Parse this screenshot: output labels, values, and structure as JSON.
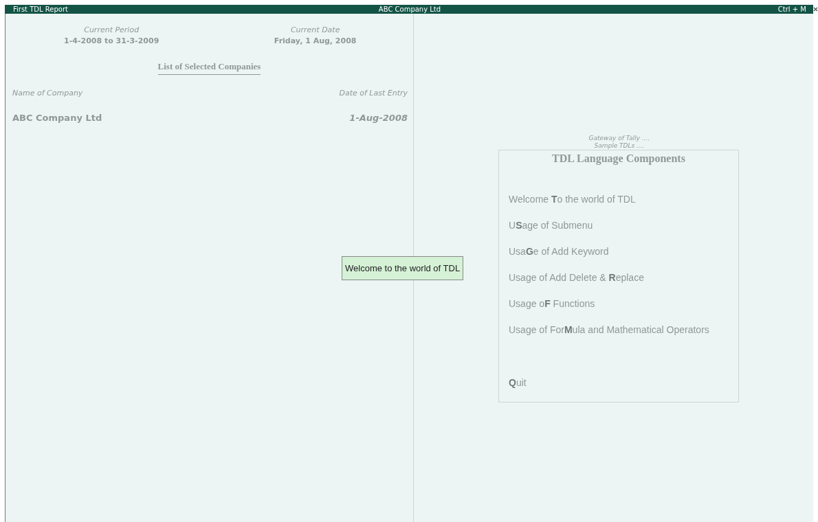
{
  "title_bar": {
    "left": "First TDL Report",
    "center": "ABC Company Ltd",
    "right": "Ctrl + M"
  },
  "period": {
    "label": "Current Period",
    "value": "1-4-2008 to 31-3-2009"
  },
  "date": {
    "label": "Current Date",
    "value": "Friday, 1 Aug, 2008"
  },
  "list_title": "List of Selected Companies",
  "columns": [
    "Name of Company",
    "Date of Last Entry"
  ],
  "rows": [
    {
      "name": "ABC Company Ltd",
      "date": "1-Aug-2008"
    }
  ],
  "breadcrumbs": [
    "Gateway of Tally ....",
    "Sample TDLs ...."
  ],
  "menu": {
    "title": "TDL Language Components",
    "items": [
      {
        "label": "Welcome **T**o the world of TDL"
      },
      {
        "label": "U**S**age of Submenu"
      },
      {
        "label": "Usa**G**e of Add Keyword"
      },
      {
        "label": "Usage of Add Delete & **R**eplace"
      },
      {
        "label": "Usage o**F** Functions"
      },
      {
        "label": "Usage of For**M**ula and Mathematical Operators"
      }
    ],
    "exit": "**Q**uit"
  },
  "popup": "Welcome to the world of TDL"
}
